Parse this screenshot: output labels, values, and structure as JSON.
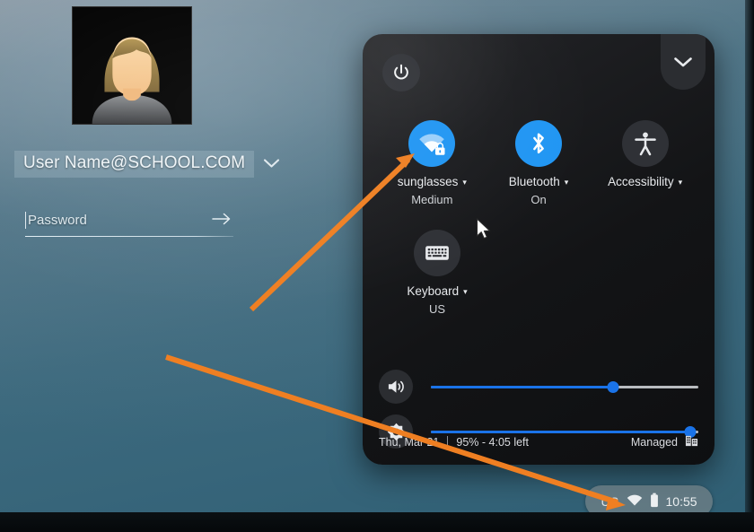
{
  "login": {
    "avatar_alt": "user-avatar-photo",
    "email": "User Name@SCHOOL.COM",
    "email_caret_icon": "chevron-down-icon",
    "password_placeholder": "Password",
    "password_value": "",
    "submit_icon": "arrow-right-icon"
  },
  "panel": {
    "power_icon": "power-icon",
    "collapse_icon": "chevron-down-icon",
    "tiles": [
      {
        "name": "network",
        "icon": "wifi-locked-icon",
        "label": "sunglasses",
        "sub": "Medium",
        "state": "on",
        "caret": "▾"
      },
      {
        "name": "bluetooth",
        "icon": "bluetooth-icon",
        "label": "Bluetooth",
        "sub": "On",
        "state": "on",
        "caret": "▾"
      },
      {
        "name": "accessibility",
        "icon": "accessibility-icon",
        "label": "Accessibility",
        "sub": "",
        "state": "off",
        "caret": "▾"
      },
      {
        "name": "keyboard",
        "icon": "keyboard-icon",
        "label": "Keyboard",
        "sub": "US",
        "state": "off",
        "caret": "▾"
      }
    ],
    "sliders": [
      {
        "name": "volume",
        "icon": "volume-up-icon",
        "value": 68
      },
      {
        "name": "brightness",
        "icon": "brightness-icon",
        "value": 97
      }
    ],
    "footer": {
      "date": "Thu, Mar 21",
      "battery": "95% - 4:05 left",
      "managed_label": "Managed",
      "managed_icon": "enterprise-building-icon"
    }
  },
  "tray": {
    "keyboard_layout": "US",
    "wifi_icon": "wifi-icon",
    "battery_icon": "battery-icon",
    "time": "10:55"
  },
  "colors": {
    "accent_blue": "#2196f3",
    "slider_blue": "#1a73e8",
    "panel_bg": "#17181b",
    "annotation_orange": "#ef7f22",
    "desktop_blue": "#3d6a7e"
  },
  "annotations": {
    "arrow_1_target": "network-tile-icon",
    "arrow_2_target": "system-tray-pill"
  }
}
